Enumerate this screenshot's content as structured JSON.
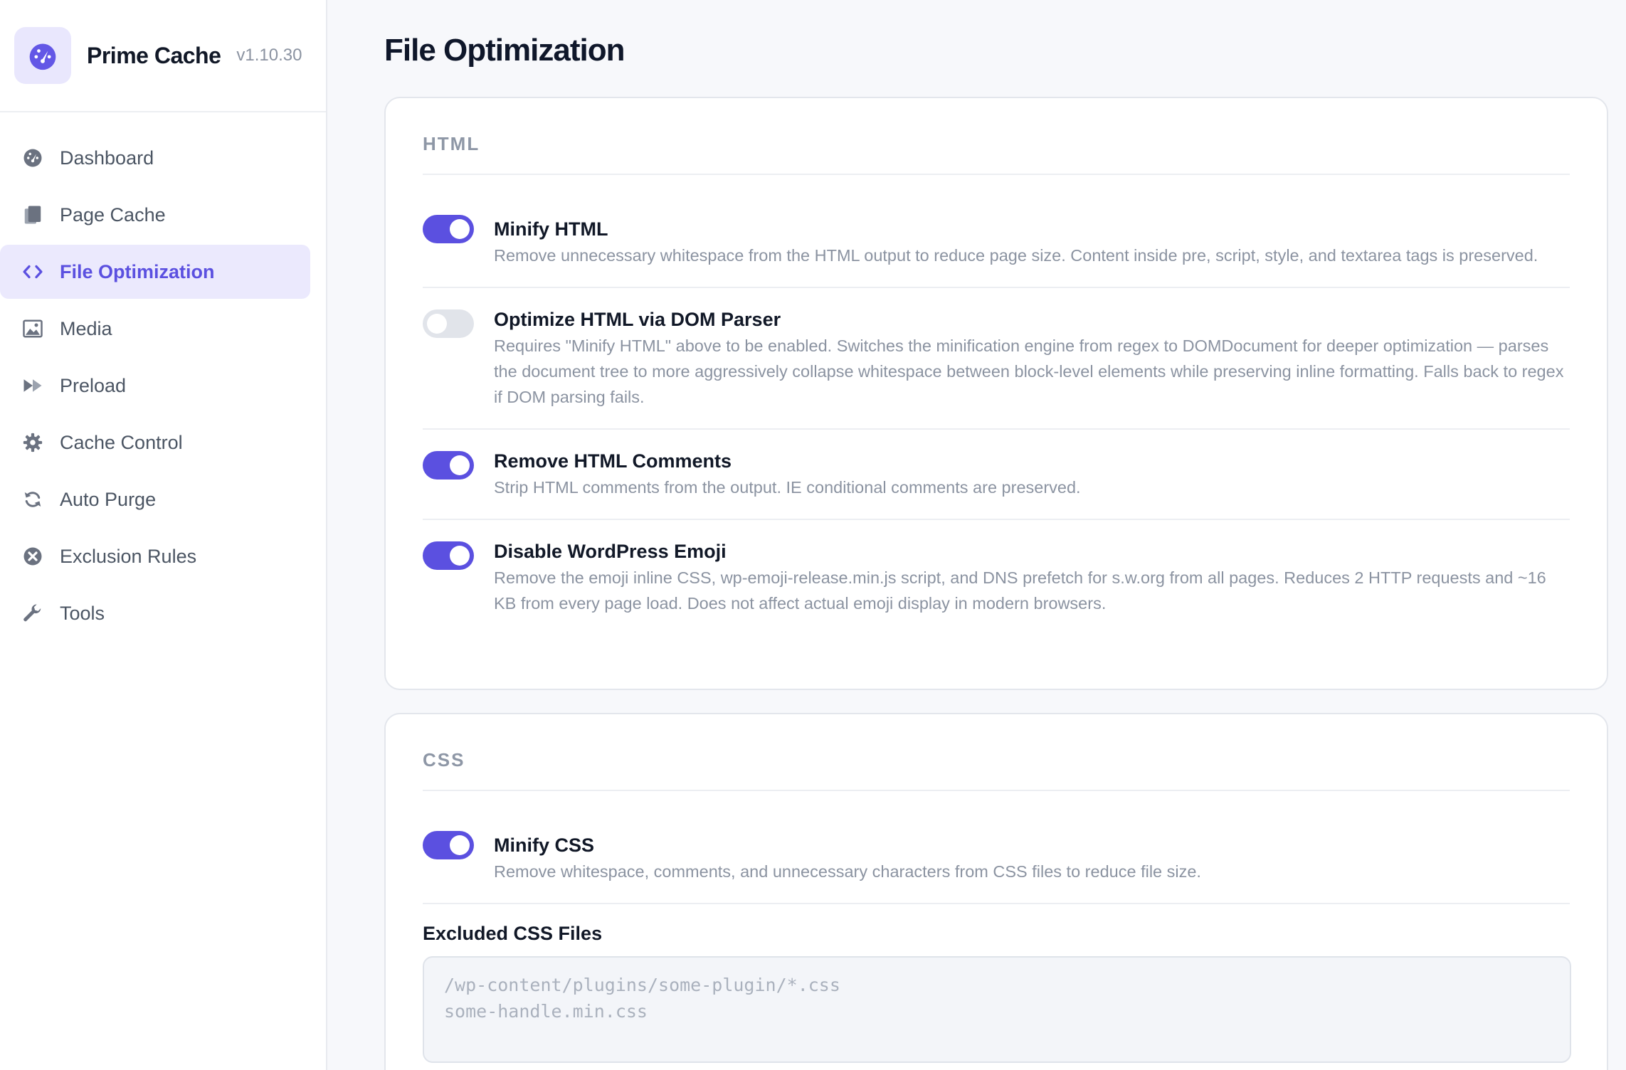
{
  "brand": {
    "name": "Prime Cache",
    "version": "v1.10.30",
    "logo_icon": "gauge-icon"
  },
  "nav": [
    {
      "label": "Dashboard",
      "icon": "dashboard-icon",
      "active": false
    },
    {
      "label": "Page Cache",
      "icon": "page-cache-icon",
      "active": false
    },
    {
      "label": "File Optimization",
      "icon": "code-icon",
      "active": true
    },
    {
      "label": "Media",
      "icon": "image-icon",
      "active": false
    },
    {
      "label": "Preload",
      "icon": "fast-forward-icon",
      "active": false
    },
    {
      "label": "Cache Control",
      "icon": "gear-icon",
      "active": false
    },
    {
      "label": "Auto Purge",
      "icon": "refresh-icon",
      "active": false
    },
    {
      "label": "Exclusion Rules",
      "icon": "x-circle-icon",
      "active": false
    },
    {
      "label": "Tools",
      "icon": "wrench-icon",
      "active": false
    }
  ],
  "page": {
    "title": "File Optimization"
  },
  "html_section": {
    "heading": "HTML",
    "settings": [
      {
        "title": "Minify HTML",
        "enabled": true,
        "desc": "Remove unnecessary whitespace from the HTML output to reduce page size. Content inside pre, script, style, and textarea tags is preserved."
      },
      {
        "title": "Optimize HTML via DOM Parser",
        "enabled": false,
        "desc": "Requires \"Minify HTML\" above to be enabled. Switches the minification engine from regex to DOMDocument for deeper optimization — parses the document tree to more aggressively collapse whitespace between block-level elements while preserving inline formatting. Falls back to regex if DOM parsing fails."
      },
      {
        "title": "Remove HTML Comments",
        "enabled": true,
        "desc": "Strip HTML comments from the output. IE conditional comments are preserved."
      },
      {
        "title": "Disable WordPress Emoji",
        "enabled": true,
        "desc": "Remove the emoji inline CSS, wp-emoji-release.min.js script, and DNS prefetch for s.w.org from all pages. Reduces 2 HTTP requests and ~16 KB from every page load. Does not affect actual emoji display in modern browsers."
      }
    ]
  },
  "css_section": {
    "heading": "CSS",
    "settings": [
      {
        "title": "Minify CSS",
        "enabled": true,
        "desc": "Remove whitespace, comments, and unnecessary characters from CSS files to reduce file size."
      }
    ],
    "excluded_label": "Excluded CSS Files",
    "excluded_placeholder": "/wp-content/plugins/some-plugin/*.css\nsome-handle.min.css"
  },
  "colors": {
    "accent": "#5b50e0",
    "accent_bg": "#ebe9fd",
    "toggle_off": "#e1e4ea"
  }
}
